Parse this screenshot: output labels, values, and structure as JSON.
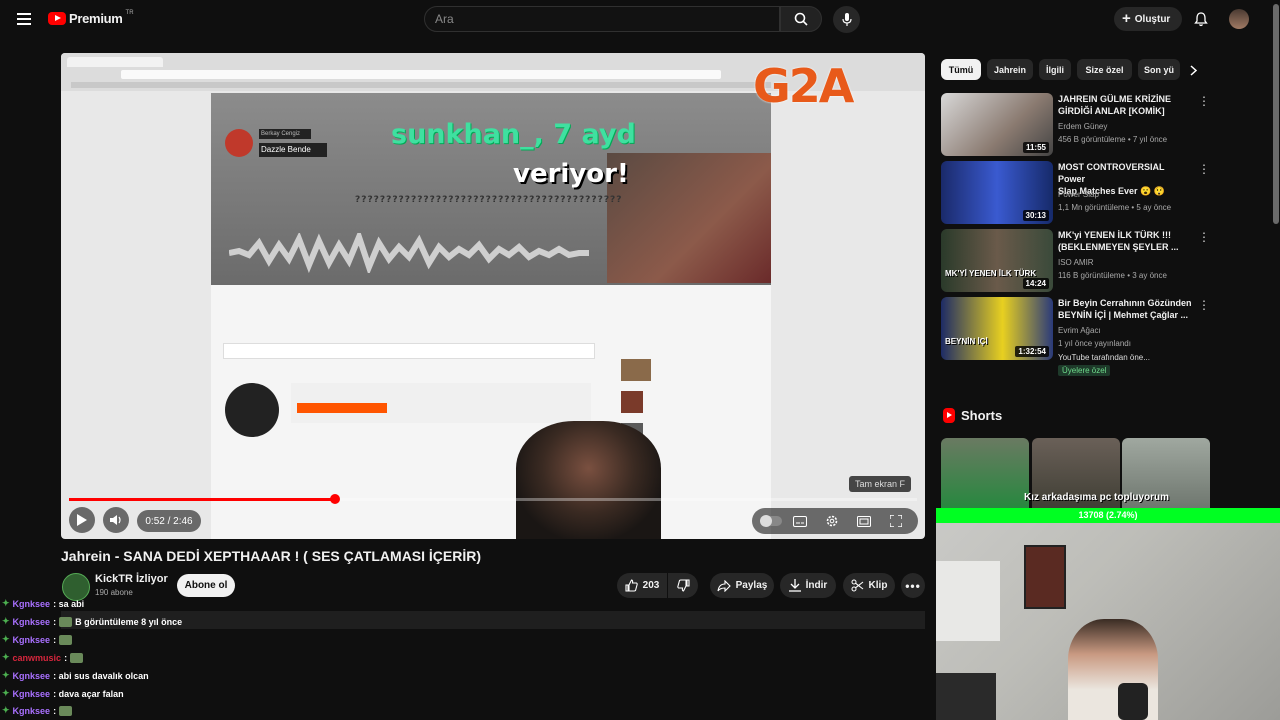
{
  "header": {
    "logo_text": "Premium",
    "logo_region": "TR",
    "search_placeholder": "Ara",
    "create_label": "Oluştur"
  },
  "player": {
    "overlay_text_1": "sunkhan_, 7 ayd",
    "overlay_text_2": "veriyor!",
    "overlay_text_3": "???????????????????????????????????????????",
    "brand_watermark": "G2A",
    "soundcloud_artist": "Berkay Cengiz",
    "soundcloud_track": "Dazzle Bende",
    "time_display": "0:52 / 2:46",
    "progress_fraction": 0.314,
    "fullscreen_tooltip": "Tam ekran  F"
  },
  "video": {
    "title": "Jahrein - SANA DEDİ XEPTHAAAR ! ( SES ÇATLAMASI İÇERİR)",
    "channel_name": "KickTR İzliyor",
    "subscribers": "190 abone",
    "subscribe_label": "Abone ol",
    "likes": "203",
    "share_label": "Paylaş",
    "download_label": "İndir",
    "clip_label": "Klip"
  },
  "chat": [
    {
      "user": "Kgnksee",
      "message": ": sa abi",
      "color": "#a970ff"
    },
    {
      "user": "Kgnksee",
      "message": ": ",
      "extra": "B görüntüleme  8 yıl önce",
      "color": "#a970ff"
    },
    {
      "user": "Kgnksee",
      "message": ": ",
      "color": "#a970ff"
    },
    {
      "user": "canwmusic",
      "message": ": ",
      "color": "#d7263d"
    },
    {
      "user": "Kgnksee",
      "message": ": abi sus davalık olcan",
      "color": "#a970ff"
    },
    {
      "user": "Kgnksee",
      "message": ": dava açar falan",
      "color": "#a970ff"
    },
    {
      "user": "Kgnksee",
      "message": ": ",
      "color": "#a970ff"
    }
  ],
  "sidebar": {
    "chips": [
      "Tümü",
      "Jahrein",
      "İlgili",
      "Size özel",
      "Son yü"
    ],
    "related": [
      {
        "title_line1": "JAHREIN GÜLME KRİZİNE",
        "title_line2": "GİRDİĞİ ANLAR [KOMİK]",
        "channel": "Erdem Güney",
        "meta": "456 B görüntüleme • 7 yıl önce",
        "duration": "11:55"
      },
      {
        "title_line1": "MOST CONTROVERSIAL Power",
        "title_line2": "Slap Matches Ever 😮 😲",
        "channel": "Power Slap",
        "meta": "1,1 Mn görüntüleme • 5 ay önce",
        "duration": "30:13"
      },
      {
        "title_line1": "MK'yi YENEN İLK TÜRK !!!",
        "title_line2": "(BEKLENMEYEN ŞEYLER ...",
        "channel": "ISO AMIR",
        "meta": "116 B görüntüleme • 3 ay önce",
        "duration": "14:24",
        "thumb_caption": "MK'Yİ YENEN İLK TÜRK"
      },
      {
        "title_line1": "Bir Beyin Cerrahının Gözünden",
        "title_line2": "BEYNİN İÇİ | Mehmet Çağlar ...",
        "channel": "Evrim Ağacı",
        "meta": "1 yıl önce yayınlandı",
        "extra": "YouTube tarafından öne...",
        "badge": "Üyelere özel",
        "duration": "1:32:54",
        "thumb_caption": "BEYNİN İÇİ"
      }
    ],
    "shorts_title": "Shorts"
  },
  "stream_overlay": {
    "shorts_caption": "Kız arkadaşıma pc topluyorum",
    "goal_text": "13708 (2.74%)"
  },
  "colors": {
    "background": "#0f0f0f",
    "accent_red": "#ff0000",
    "chat_username": "#a970ff",
    "chat_badge": "#4caf50",
    "goal_bar": "#00ff22"
  }
}
